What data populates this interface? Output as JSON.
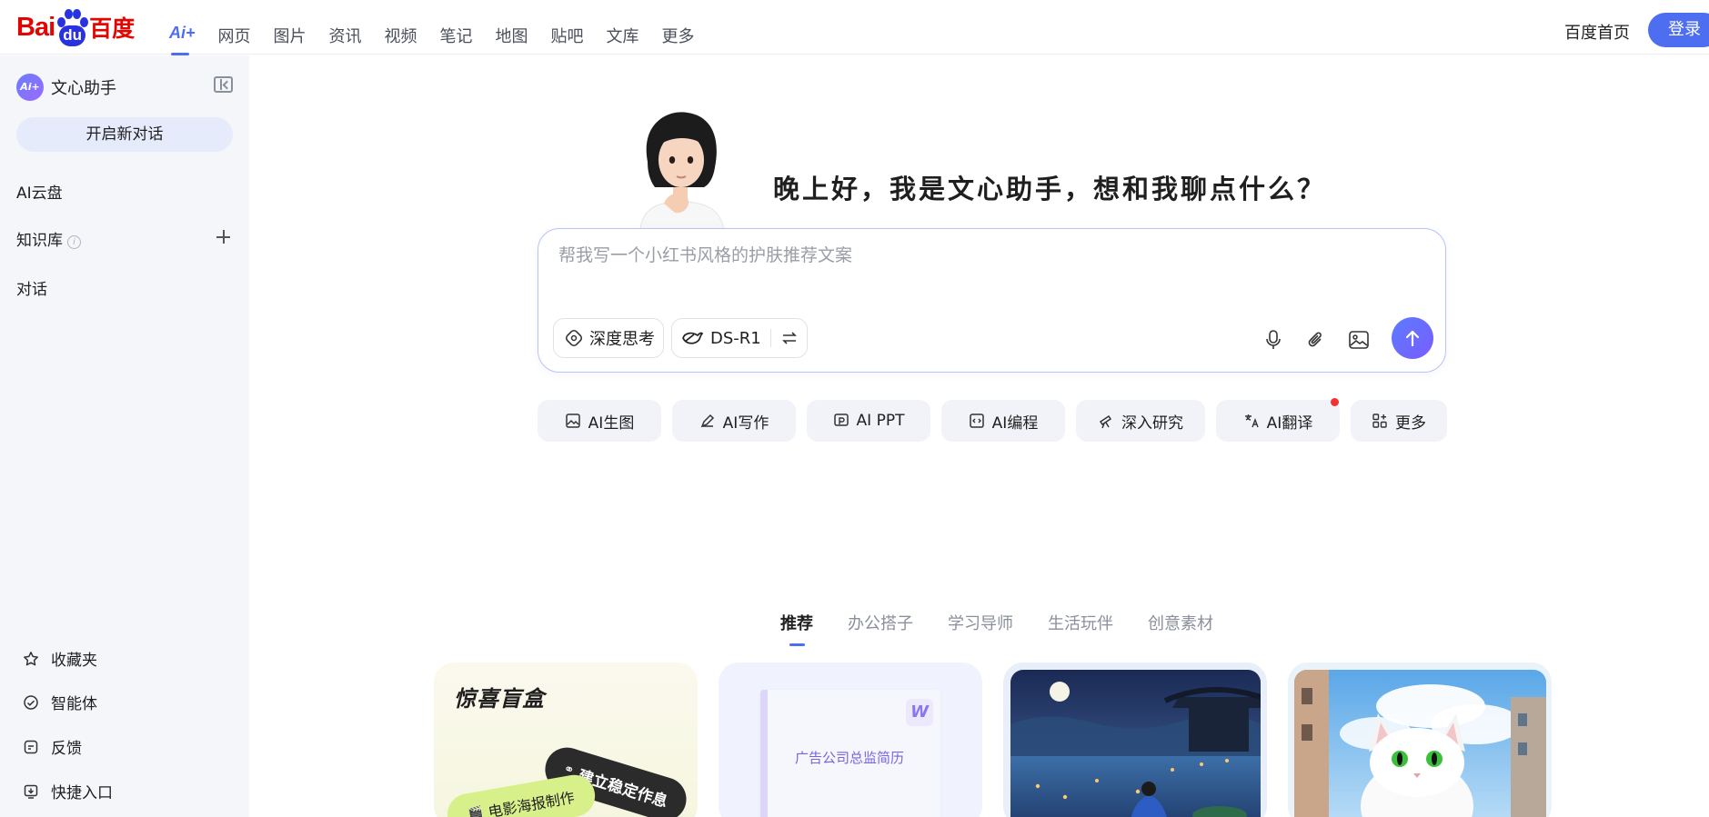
{
  "header": {
    "logo": {
      "left": "Bai",
      "paw": "du",
      "right": "百度"
    },
    "nav": [
      {
        "label": "Ai+"
      },
      {
        "label": "网页"
      },
      {
        "label": "图片"
      },
      {
        "label": "资讯"
      },
      {
        "label": "视频"
      },
      {
        "label": "笔记"
      },
      {
        "label": "地图"
      },
      {
        "label": "贴吧"
      },
      {
        "label": "文库"
      },
      {
        "label": "更多"
      }
    ],
    "home_link": "百度首页",
    "login_label": "登录"
  },
  "sidebar": {
    "assistant_avatar": "Ai+",
    "assistant_name": "文心助手",
    "new_chat_label": "开启新对话",
    "links": {
      "cloud": "AI云盘",
      "knowledge": "知识库",
      "knowledge_info": "i",
      "chats": "对话"
    },
    "bottom": [
      {
        "label": "收藏夹",
        "icon": "star-icon"
      },
      {
        "label": "智能体",
        "icon": "agent-icon"
      },
      {
        "label": "反馈",
        "icon": "feedback-icon"
      },
      {
        "label": "快捷入口",
        "icon": "shortcut-icon"
      }
    ]
  },
  "main": {
    "greeting": "晚上好，我是文心助手，想和我聊点什么？",
    "input_placeholder": "帮我写一个小红书风格的护肤推荐文案",
    "deep_think_label": "深度思考",
    "model_label": "DS-R1",
    "quick_actions": [
      {
        "label": "AI生图",
        "icon": "image-gen-icon"
      },
      {
        "label": "AI写作",
        "icon": "pen-icon"
      },
      {
        "label": "AI PPT",
        "icon": "ppt-icon"
      },
      {
        "label": "AI编程",
        "icon": "code-icon"
      },
      {
        "label": "深入研究",
        "icon": "telescope-icon"
      },
      {
        "label": "AI翻译",
        "icon": "translate-icon"
      },
      {
        "label": "更多",
        "icon": "grid-plus-icon"
      }
    ],
    "category_tabs": [
      {
        "label": "推荐"
      },
      {
        "label": "办公搭子"
      },
      {
        "label": "学习导师"
      },
      {
        "label": "生活玩伴"
      },
      {
        "label": "创意素材"
      }
    ],
    "cards": {
      "surprise_title": "惊喜盲盒",
      "surprise_pill_dark": "建立稳定作息",
      "surprise_pill_green": "电影海报制作",
      "resume_label": "广告公司总监简历",
      "resume_badge": "W"
    }
  },
  "colors": {
    "brand_red": "#e10601",
    "brand_blue": "#2932e1",
    "accent": "#4e6ef2",
    "sidebar_bg": "#f5f6fa",
    "notification": "#f33131"
  }
}
